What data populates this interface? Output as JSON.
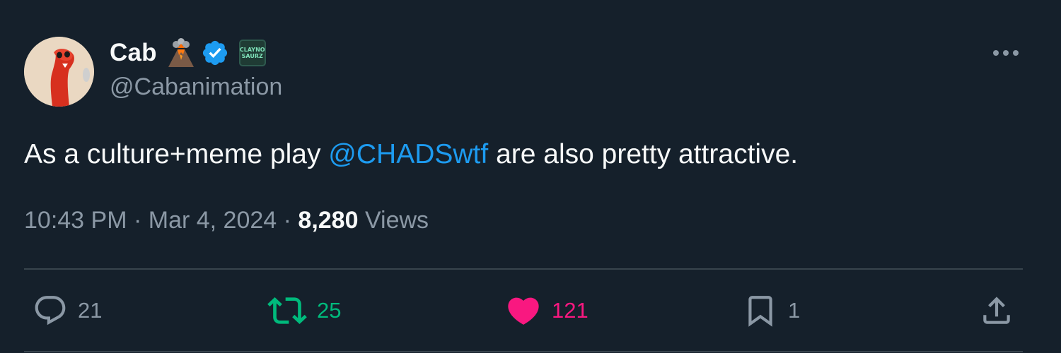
{
  "author": {
    "display_name": "Cab",
    "handle": "@Cabanimation",
    "name_emoji": "volcano-icon",
    "verified": true,
    "affiliate_badge_text": [
      "CLAYNO",
      "SAURZ"
    ]
  },
  "tweet": {
    "text_before": "As a culture+meme play ",
    "mention": "@CHADSwtf",
    "text_after": " are also pretty attractive."
  },
  "meta": {
    "time": "10:43 PM",
    "sep1": " · ",
    "date": "Mar 4, 2024",
    "sep2": " · ",
    "views_count": "8,280",
    "views_label": " Views"
  },
  "actions": {
    "replies": "21",
    "retweets": "25",
    "likes": "121",
    "bookmarks": "1"
  },
  "colors": {
    "background": "#15202b",
    "text": "#f7f9f9",
    "secondary": "#8b98a5",
    "link": "#1d9bf0",
    "retweet": "#00ba7c",
    "like": "#f91880"
  }
}
